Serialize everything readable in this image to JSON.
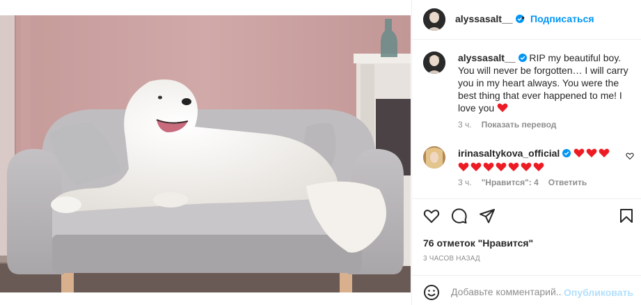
{
  "post": {
    "username": "alyssasalt__",
    "separator": "•",
    "follow_label": "Подписаться"
  },
  "caption": {
    "username": "alyssasalt__",
    "text": "RIP my beautiful boy. You will never be forgotten… I will carry you in my heart always. You were the best thing that ever happened to me! I love you",
    "age": "3 ч.",
    "translate_label": "Показать перевод"
  },
  "comment": {
    "username": "irinasaltykova_official",
    "age": "3 ч.",
    "likes_label": "\"Нравится\": 4",
    "reply_label": "Ответить",
    "heart_count": 10
  },
  "actions": {
    "likes_text": "76 отметок \"Нравится\"",
    "time_text": "3 ЧАСОВ НАЗАД"
  },
  "add_comment": {
    "placeholder": "Добавьте комментарий...",
    "publish_label": "Опубликовать"
  },
  "colors": {
    "accent": "#0095f6",
    "publish_disabled": "#b2dffc",
    "heart": "#ed1c24",
    "wall": "#c9a1a0"
  },
  "icons": [
    "verified-icon",
    "heart-icon",
    "comment-icon",
    "share-icon",
    "bookmark-icon",
    "smile-icon",
    "red-heart-icon"
  ]
}
